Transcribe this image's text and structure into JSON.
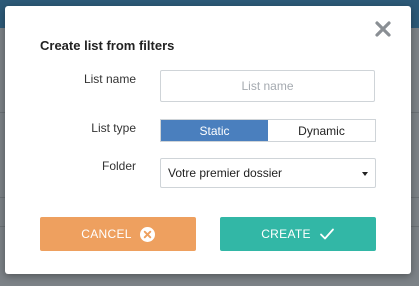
{
  "dialog": {
    "title": "Create list from filters",
    "close_icon": "close-icon"
  },
  "form": {
    "list_name": {
      "label": "List name",
      "placeholder": "List name",
      "value": ""
    },
    "list_type": {
      "label": "List type",
      "options": [
        "Static",
        "Dynamic"
      ],
      "selected": "Static"
    },
    "folder": {
      "label": "Folder",
      "selected": "Votre premier dossier"
    }
  },
  "actions": {
    "cancel_label": "CANCEL",
    "cancel_icon": "circle-x-icon",
    "create_label": "CREATE",
    "create_icon": "checkmark-icon"
  },
  "colors": {
    "accent_active": "#4a7fbe",
    "cancel": "#eea05f",
    "create": "#32b7a6"
  }
}
